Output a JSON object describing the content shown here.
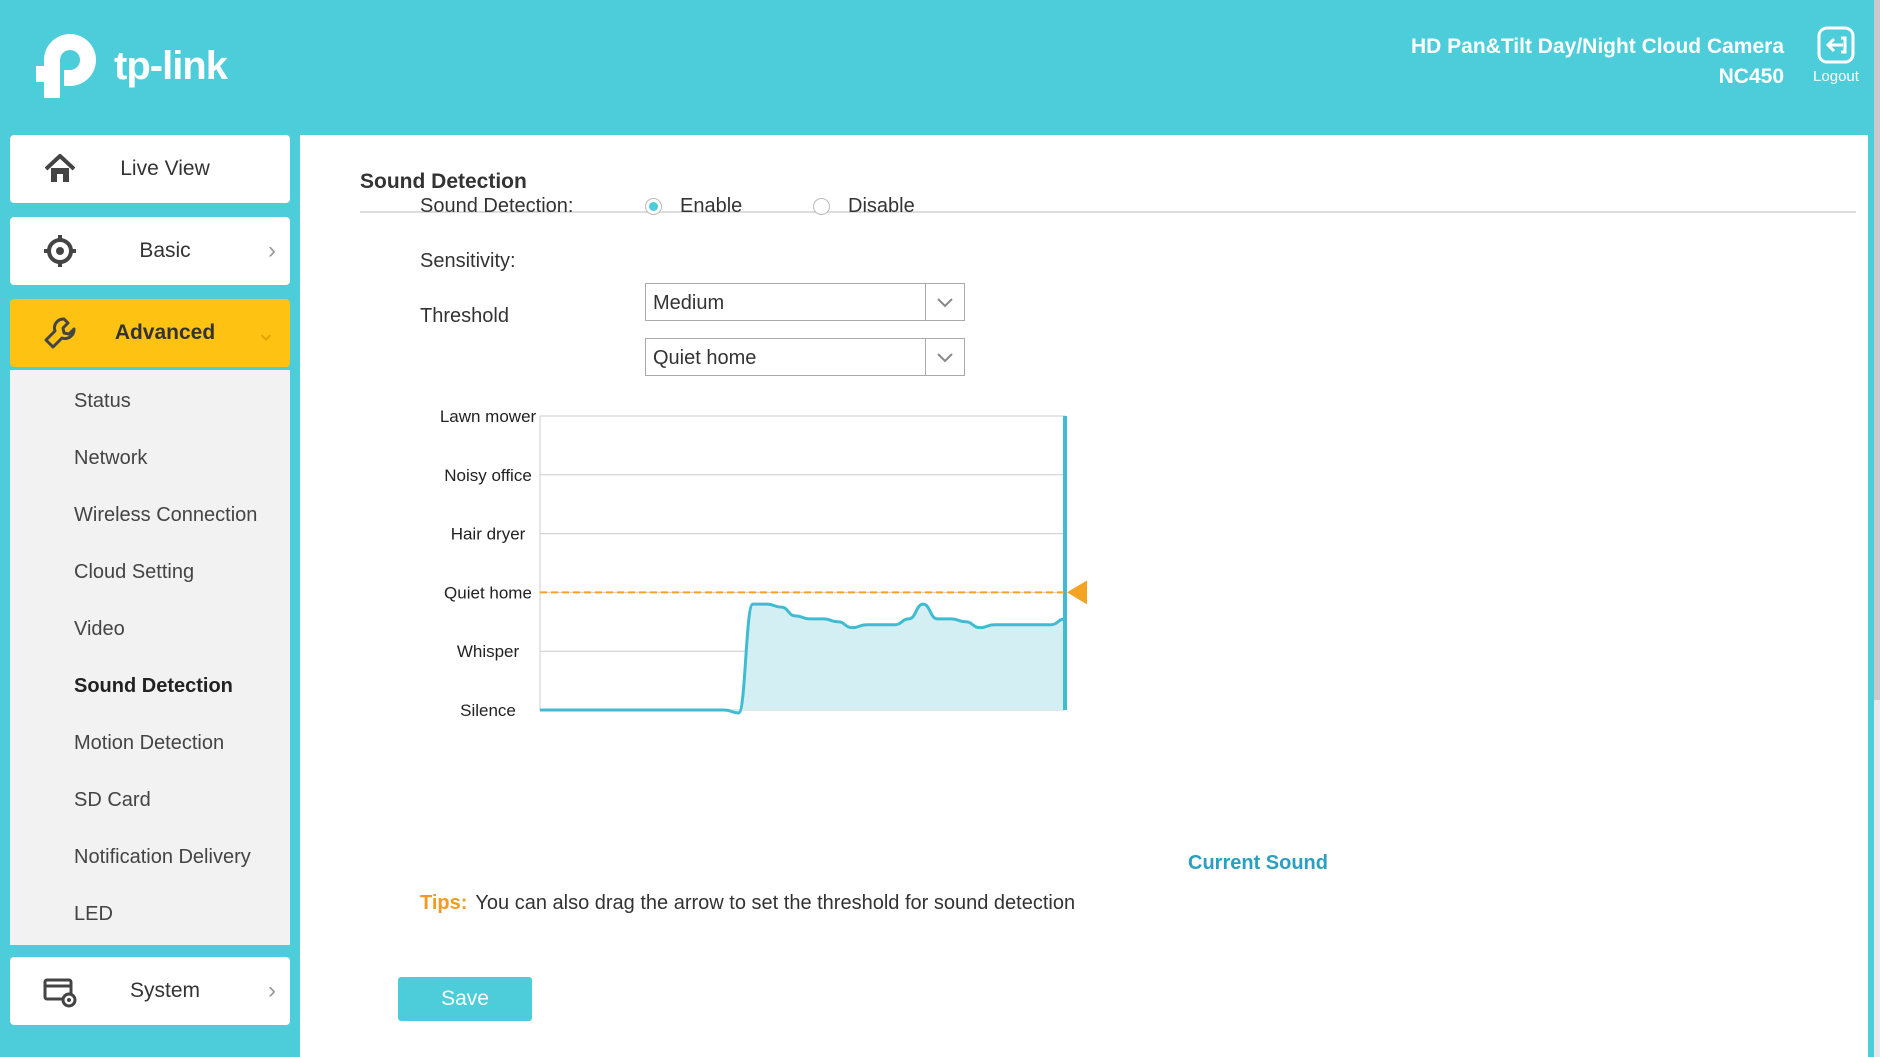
{
  "brand": {
    "logo_text": "tp-link"
  },
  "header": {
    "product_name": "HD Pan&Tilt Day/Night Cloud Camera",
    "model": "NC450",
    "logout_label": "Logout"
  },
  "sidebar": {
    "live_view": "Live View",
    "basic": "Basic",
    "advanced": "Advanced",
    "system": "System",
    "advanced_items": [
      "Status",
      "Network",
      "Wireless Connection",
      "Cloud Setting",
      "Video",
      "Sound Detection",
      "Motion Detection",
      "SD Card",
      "Notification Delivery",
      "LED"
    ],
    "current_item": "Sound Detection"
  },
  "page": {
    "title": "Sound Detection"
  },
  "form": {
    "sound_detection_label": "Sound Detection:",
    "enable_label": "Enable",
    "disable_label": "Disable",
    "sound_detection_value": "Enable",
    "sensitivity_label": "Sensitivity:",
    "sensitivity_value": "Medium",
    "threshold_label": "Threshold",
    "threshold_value": "Quiet home"
  },
  "chart_data": {
    "type": "area",
    "levels": [
      "Silence",
      "Whisper",
      "Quiet home",
      "Hair dryer",
      "Noisy office",
      "Lawn mower"
    ],
    "threshold_level": "Quiet home",
    "current_label": "Current Sound",
    "series": [
      {
        "values": [
          0,
          0,
          0,
          0,
          0,
          0,
          0,
          0,
          0,
          0,
          0,
          0,
          0,
          0,
          -0.05,
          1.8,
          1.8,
          1.75,
          1.6,
          1.55,
          1.55,
          1.5,
          1.4,
          1.45,
          1.45,
          1.45,
          1.55,
          1.8,
          1.55,
          1.55,
          1.5,
          1.4,
          1.45,
          1.45,
          1.45,
          1.45,
          1.45,
          1.55
        ]
      }
    ],
    "colors": {
      "area": "#d3eff3",
      "line": "#40bcd2",
      "threshold": "#f4a323"
    }
  },
  "tips": {
    "key": "Tips:",
    "text": "You can also drag the arrow to set the threshold for sound detection"
  },
  "actions": {
    "save_label": "Save"
  }
}
